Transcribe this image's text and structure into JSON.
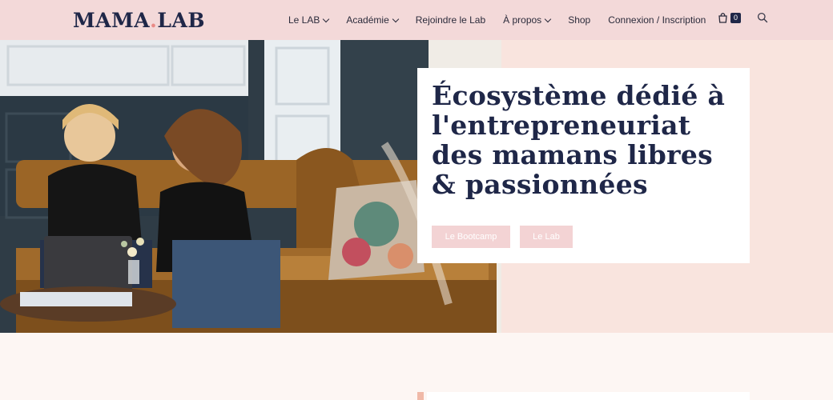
{
  "header": {
    "logo_main": "MAMA",
    "logo_dot": ".",
    "logo_end": "LAB",
    "nav": [
      {
        "label": "Le LAB",
        "has_dropdown": true
      },
      {
        "label": "Académie",
        "has_dropdown": true
      },
      {
        "label": "Rejoindre le Lab",
        "has_dropdown": false
      },
      {
        "label": "À propos",
        "has_dropdown": true
      },
      {
        "label": "Shop",
        "has_dropdown": false
      },
      {
        "label": "Connexion / Inscription",
        "has_dropdown": false
      }
    ],
    "cart_count": "0",
    "icons": {
      "cart": "shopping-bag-icon",
      "search": "search-icon"
    }
  },
  "hero": {
    "title": "Écosystème dédié à l'entrepreneuriat des mamans libres & passionnées",
    "buttons": {
      "bootcamp": "Le Bootcamp",
      "lab": "Le Lab"
    }
  },
  "colors": {
    "header_bg": "#f3d9d9",
    "brand_navy": "#1f2748",
    "button_pink": "#f3d3d4",
    "hero_side_bg": "#f9e4de",
    "accent_peach": "#f0b9a8"
  }
}
